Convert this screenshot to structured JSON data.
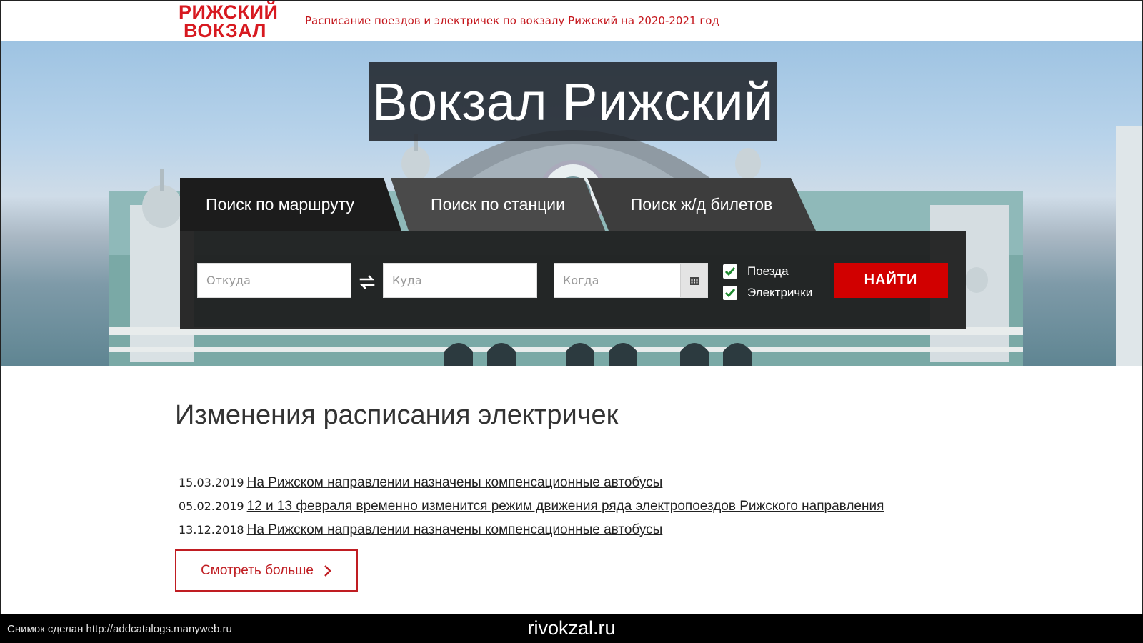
{
  "header": {
    "logo_line1": "РИЖСКИЙ",
    "logo_line2": "ВОКЗАЛ",
    "tagline": "Расписание поездов и электричек по вокзалу Рижский на 2020-2021 год"
  },
  "hero": {
    "title": "Вокзал Рижский"
  },
  "tabs": [
    {
      "label": "Поиск по маршруту",
      "active": true
    },
    {
      "label": "Поиск по станции",
      "active": false
    },
    {
      "label": "Поиск ж/д билетов",
      "active": false
    }
  ],
  "search": {
    "from_placeholder": "Откуда",
    "to_placeholder": "Куда",
    "when_placeholder": "Когда",
    "check_trains": "Поезда",
    "check_elektrichki": "Электрички",
    "find_label": "НАЙТИ"
  },
  "news": {
    "title": "Изменения расписания электричек",
    "items": [
      {
        "date": "15.03.2019",
        "text": "На Рижском направлении назначены компенсационные автобусы"
      },
      {
        "date": "05.02.2019",
        "text": "12 и 13 февраля временно изменится режим движения ряда электропоездов Рижского направления"
      },
      {
        "date": "13.12.2018",
        "text": "На Рижском направлении назначены компенсационные автобусы"
      }
    ],
    "more_label": "Смотреть больше"
  },
  "footer": {
    "caption": "Снимок сделан http://addcatalogs.manyweb.ru",
    "site": "rivokzal.ru"
  },
  "colors": {
    "brand_red": "#d71920",
    "button_red": "#d10000",
    "panel_dark": "#1c1c1c"
  },
  "icons": [
    "swap-icon",
    "calendar-icon",
    "checkmark-icon",
    "chevron-right-icon"
  ]
}
